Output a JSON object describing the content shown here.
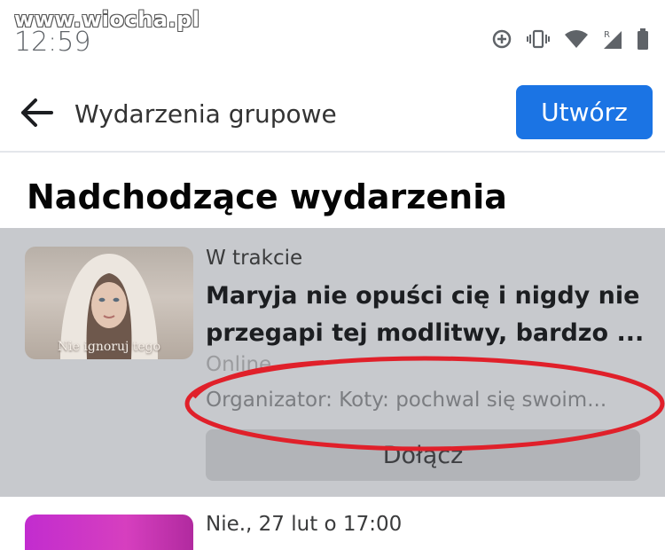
{
  "watermark": "www.wiocha.pl",
  "status_bar": {
    "time": "12:59",
    "icons": [
      "data-saver-icon",
      "vibrate-icon",
      "wifi-icon",
      "signal-roaming-icon",
      "battery-icon"
    ]
  },
  "header": {
    "title": "Wydarzenia grupowe",
    "create_label": "Utwórz",
    "accent": "#1b74e4"
  },
  "section_title": "Nadchodzące wydarzenia",
  "events": [
    {
      "thumbnail_caption": "Nie ignoruj tego",
      "status": "W trakcie",
      "title_line1": "Maryja nie opuści cię i nigdy nie",
      "title_line2": "przegapi tej modlitwy, bardzo ...",
      "location": "Online",
      "organizer": "Organizator: Koty: pochwal się swoim...",
      "join_label": "Dołącz"
    },
    {
      "date": "Nie., 27 lut o 17:00"
    }
  ],
  "annotation_color": "#e0202a"
}
